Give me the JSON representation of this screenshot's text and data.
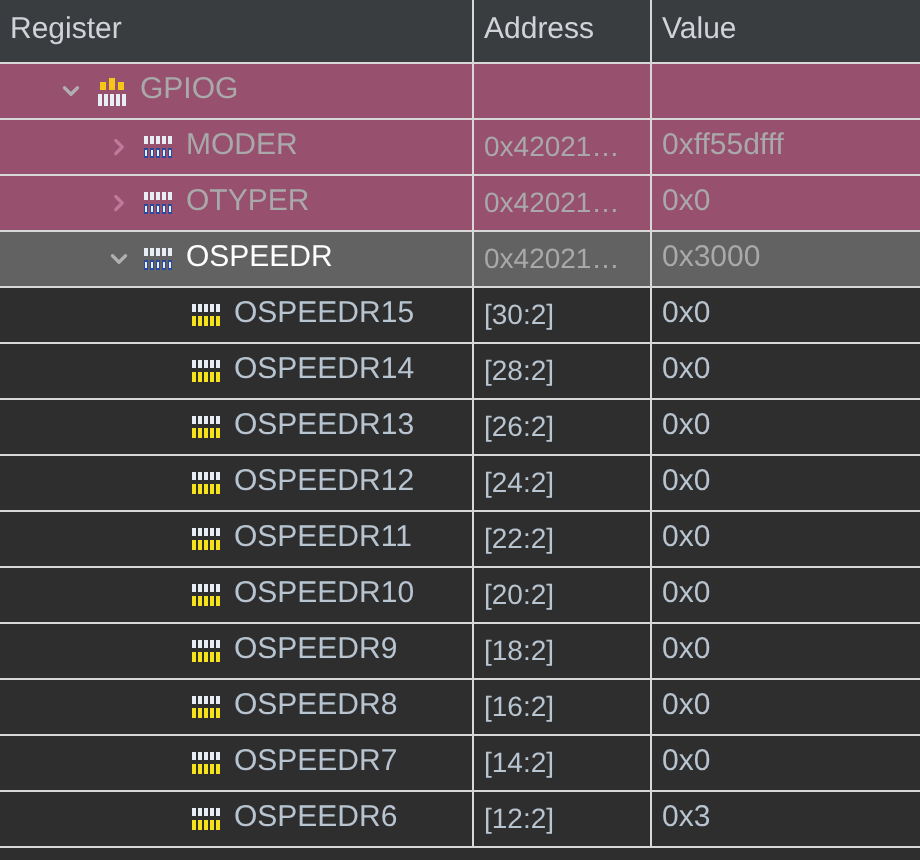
{
  "columns": [
    "Register",
    "Address",
    "Value"
  ],
  "rows": [
    {
      "kind": "peripheral",
      "name": "GPIOG",
      "address": "",
      "value": "",
      "changed": true,
      "selected": false,
      "expanded": true,
      "children": [
        {
          "kind": "register",
          "name": "MODER",
          "address": "0x42021…",
          "value": "0xff55dfff",
          "changed": true,
          "selected": false,
          "expanded": false
        },
        {
          "kind": "register",
          "name": "OTYPER",
          "address": "0x42021…",
          "value": "0x0",
          "changed": true,
          "selected": false,
          "expanded": false
        },
        {
          "kind": "register",
          "name": "OSPEEDR",
          "address": "0x42021…",
          "value": "0x3000",
          "changed": false,
          "selected": true,
          "expanded": true,
          "children": [
            {
              "kind": "field",
              "name": "OSPEEDR15",
              "address": "[30:2]",
              "value": "0x0"
            },
            {
              "kind": "field",
              "name": "OSPEEDR14",
              "address": "[28:2]",
              "value": "0x0"
            },
            {
              "kind": "field",
              "name": "OSPEEDR13",
              "address": "[26:2]",
              "value": "0x0"
            },
            {
              "kind": "field",
              "name": "OSPEEDR12",
              "address": "[24:2]",
              "value": "0x0"
            },
            {
              "kind": "field",
              "name": "OSPEEDR11",
              "address": "[22:2]",
              "value": "0x0"
            },
            {
              "kind": "field",
              "name": "OSPEEDR10",
              "address": "[20:2]",
              "value": "0x0"
            },
            {
              "kind": "field",
              "name": "OSPEEDR9",
              "address": "[18:2]",
              "value": "0x0"
            },
            {
              "kind": "field",
              "name": "OSPEEDR8",
              "address": "[16:2]",
              "value": "0x0"
            },
            {
              "kind": "field",
              "name": "OSPEEDR7",
              "address": "[14:2]",
              "value": "0x0"
            },
            {
              "kind": "field",
              "name": "OSPEEDR6",
              "address": "[12:2]",
              "value": "0x3"
            }
          ]
        }
      ]
    }
  ]
}
